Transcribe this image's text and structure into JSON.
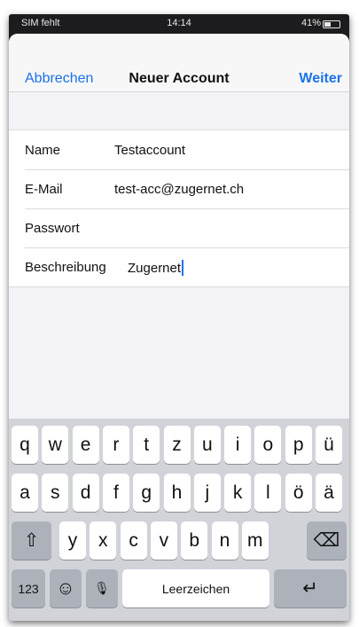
{
  "status_bar": {
    "carrier": "SIM fehlt",
    "time": "14:14",
    "battery": "41%"
  },
  "nav": {
    "cancel_label": "Abbrechen",
    "title": "Neuer Account",
    "next_label": "Weiter"
  },
  "form": {
    "rows": [
      {
        "label": "Name",
        "value": "Testaccount"
      },
      {
        "label": "E-Mail",
        "value": "test-acc@zugernet.ch"
      },
      {
        "label": "Passwort",
        "value": ""
      },
      {
        "label": "Beschreibung",
        "value": "Zugernet"
      }
    ]
  },
  "keyboard": {
    "row1": [
      "q",
      "w",
      "e",
      "r",
      "t",
      "z",
      "u",
      "i",
      "o",
      "p",
      "ü"
    ],
    "row2": [
      "a",
      "s",
      "d",
      "f",
      "g",
      "h",
      "j",
      "k",
      "l",
      "ö",
      "ä"
    ],
    "row3": [
      "y",
      "x",
      "c",
      "v",
      "b",
      "n",
      "m"
    ],
    "numbers_label": "123",
    "space_label": "Leerzeichen",
    "shift_icon": "⇧",
    "delete_icon": "⌫",
    "emoji_icon": "☺",
    "mic_icon": "🎙",
    "return_icon": "↵"
  },
  "colors": {
    "accent": "#1a73e8",
    "keyboard_bg": "#d1d3d9",
    "dark_key": "#adb1ba"
  }
}
